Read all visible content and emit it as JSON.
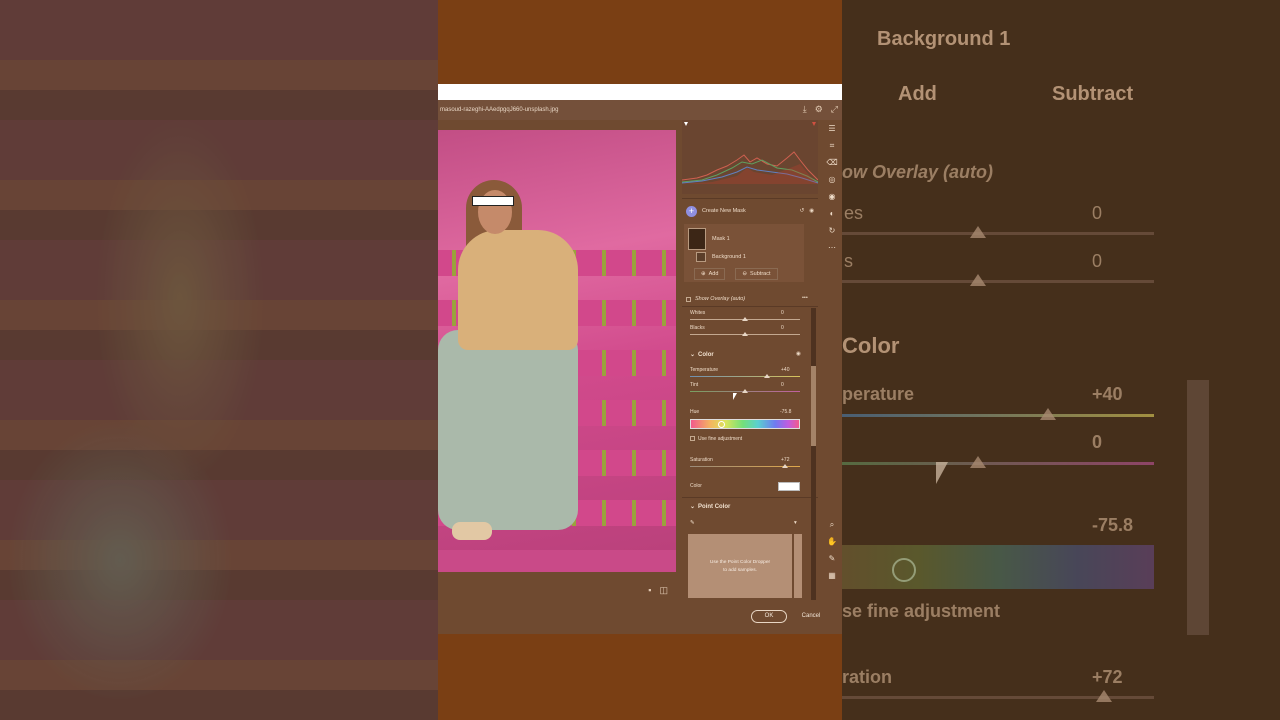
{
  "background_right": {
    "background_label": "Background 1",
    "add_label": "Add",
    "subtract_label": "Subtract",
    "overlay_label": "ow Overlay (auto)",
    "whites_label": "es",
    "whites_value": "0",
    "blacks_label": "s",
    "blacks_value": "0",
    "color_title": "Color",
    "temp_label": "perature",
    "temp_value": "+40",
    "tint_value": "0",
    "hue_value": "-75.8",
    "fine_label": "se fine adjustment",
    "sat_label": "ration",
    "sat_value": "+72"
  },
  "dialog": {
    "filename": "masoud-razeghi-AAedpgqJ660-unsplash.jpg",
    "create_mask_label": "Create New Mask",
    "mask1_label": "Mask 1",
    "background_label": "Background 1",
    "add_label": "Add",
    "subtract_label": "Subtract",
    "overlay_label": "Show Overlay (auto)",
    "whites_label": "Whites",
    "whites_value": "0",
    "blacks_label": "Blacks",
    "blacks_value": "0",
    "color_section": "Color",
    "temperature_label": "Temperature",
    "temperature_value": "+40",
    "tint_label": "Tint",
    "tint_value": "0",
    "hue_label": "Hue",
    "hue_value": "-75.8",
    "fine_adjust_label": "Use fine adjustment",
    "saturation_label": "Saturation",
    "saturation_value": "+72",
    "color_label": "Color",
    "point_color_title": "Point Color",
    "dropper_text_1": "Use the Point Color Dropper",
    "dropper_text_2": "to add samples.",
    "ok_label": "OK",
    "cancel_label": "Cancel"
  },
  "colors": {
    "accent": "#8f8fe0",
    "panel_bg": "#6f4a30",
    "frame_bg": "#7a3f14"
  }
}
